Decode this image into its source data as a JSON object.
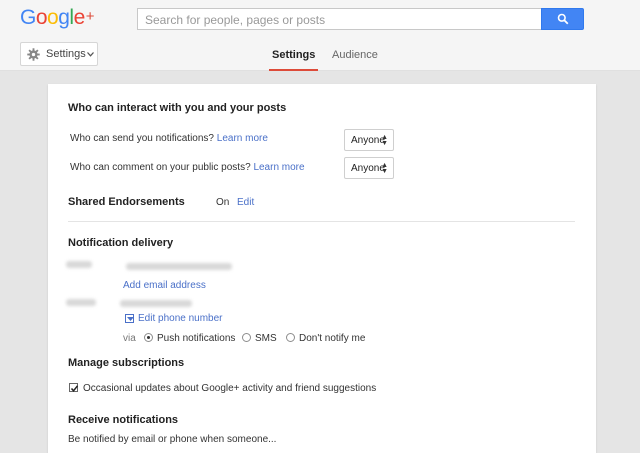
{
  "header": {
    "logo_letters": [
      "G",
      "o",
      "o",
      "g",
      "l",
      "e"
    ],
    "logo_plus": "+",
    "search_placeholder": "Search for people, pages or posts"
  },
  "subnav": {
    "dropdown_label": "Settings",
    "tabs": [
      {
        "label": "Settings",
        "active": true
      },
      {
        "label": "Audience",
        "active": false
      }
    ]
  },
  "interact": {
    "heading": "Who can interact with you and your posts",
    "notifications_q": "Who can send you notifications?",
    "notifications_link": "Learn more",
    "notifications_value": "Anyone",
    "comment_q": "Who can comment on your public posts?",
    "comment_link": "Learn more",
    "comment_value": "Anyone"
  },
  "endorsements": {
    "label": "Shared Endorsements",
    "state": "On",
    "edit": "Edit"
  },
  "delivery": {
    "heading": "Notification delivery",
    "add_email": "Add email address",
    "edit_phone": "Edit phone number",
    "via": "via",
    "options": [
      "Push notifications",
      "SMS",
      "Don't notify me"
    ],
    "selected": "Push notifications"
  },
  "subscriptions": {
    "heading": "Manage subscriptions",
    "checkbox_label": "Occasional updates about Google+ activity and friend suggestions",
    "checked": true
  },
  "receive": {
    "heading": "Receive notifications",
    "sub": "Be notified by email or phone when someone..."
  },
  "colors": {
    "accent_blue": "#4285f4",
    "link": "#4a70c8",
    "tab_underline": "#dd4b39"
  }
}
